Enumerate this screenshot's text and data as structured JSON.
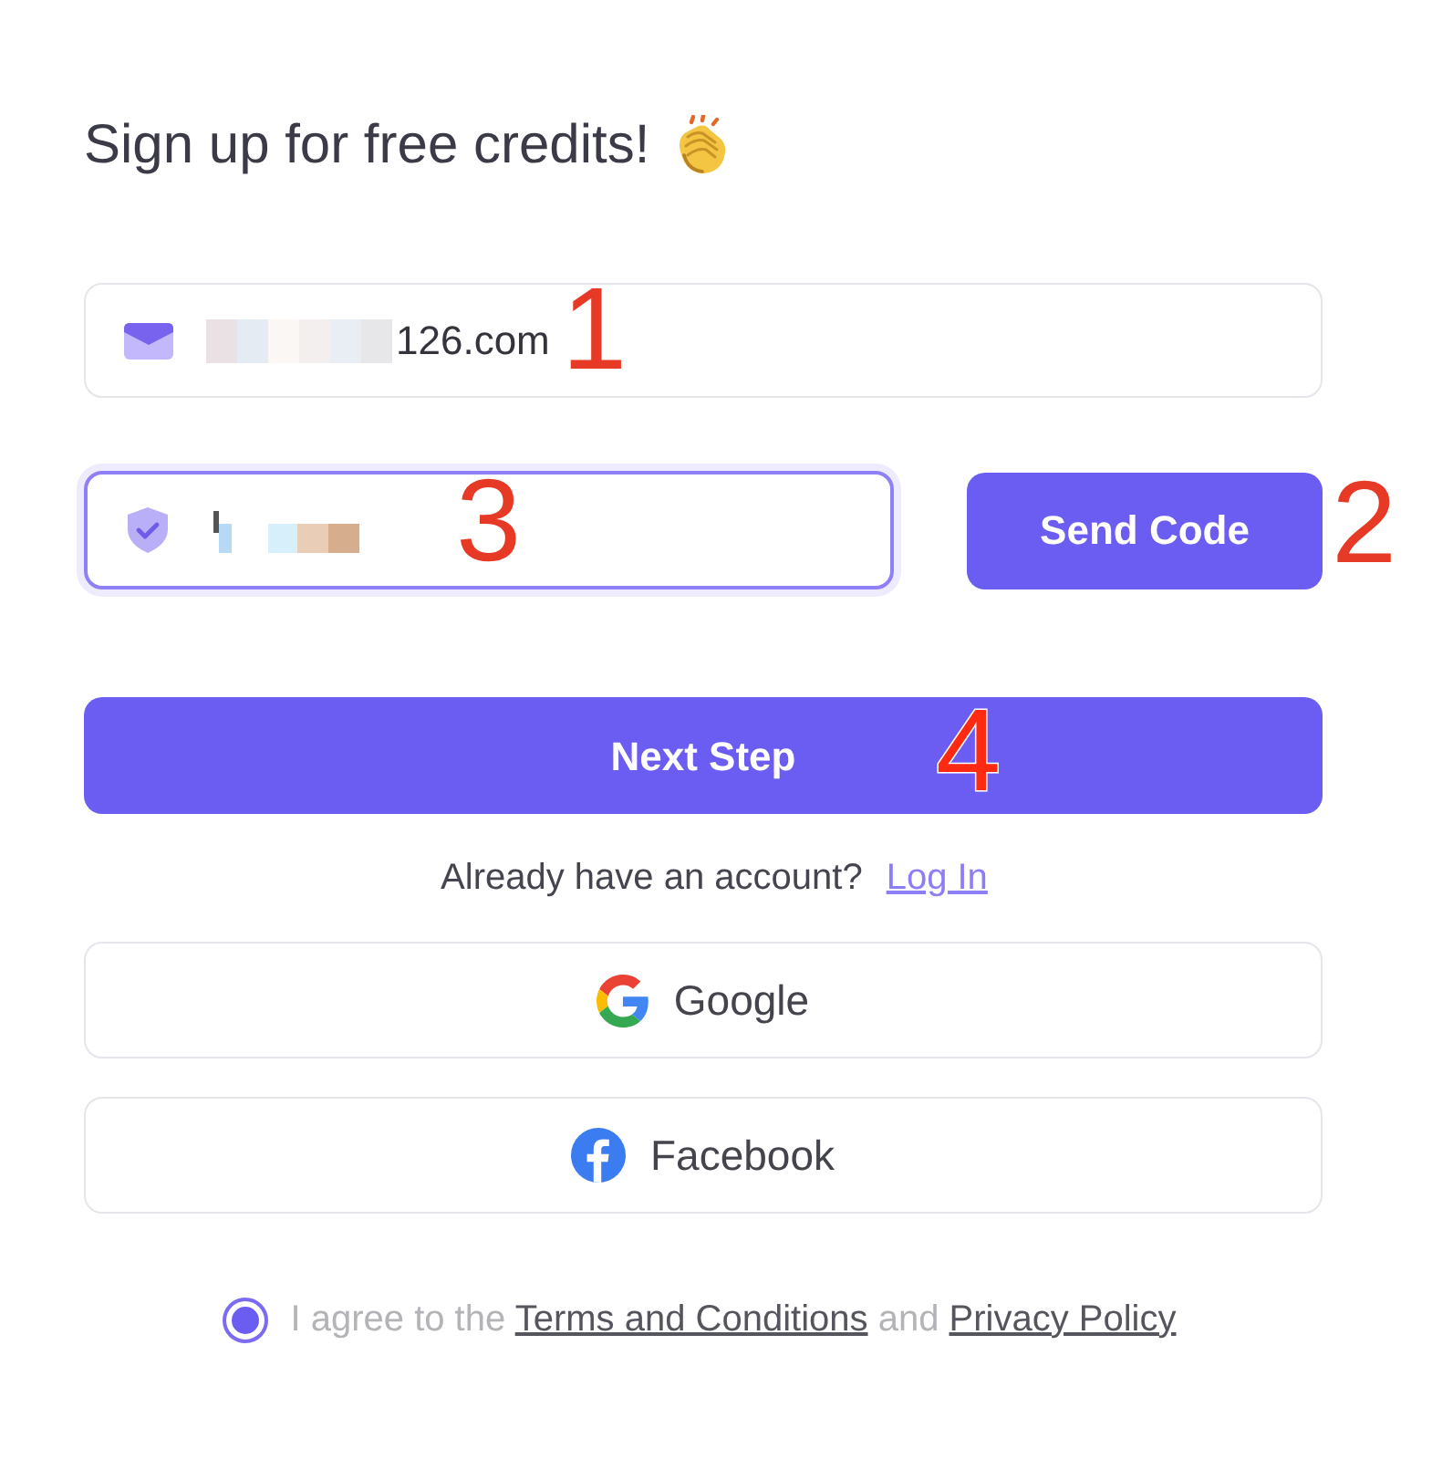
{
  "heading": {
    "text": "Sign up for free credits!"
  },
  "email_field": {
    "value": "126.com",
    "annotation": "1"
  },
  "code_field": {
    "focused": true,
    "annotation": "3"
  },
  "send_code_button": {
    "label": "Send Code",
    "annotation": "2"
  },
  "next_button": {
    "label": "Next Step",
    "annotation": "4"
  },
  "login_prompt": {
    "text": "Already have an account?",
    "link": "Log In"
  },
  "social_buttons": [
    {
      "kind": "google",
      "label": "Google"
    },
    {
      "kind": "facebook",
      "label": "Facebook"
    }
  ],
  "agreement": {
    "checked": true,
    "segments": [
      {
        "kind": "text",
        "text": "I agree to the"
      },
      {
        "kind": "link",
        "text": "Terms and Conditions"
      },
      {
        "kind": "text",
        "text": "and"
      },
      {
        "kind": "link",
        "text": "Privacy Policy"
      }
    ]
  }
}
